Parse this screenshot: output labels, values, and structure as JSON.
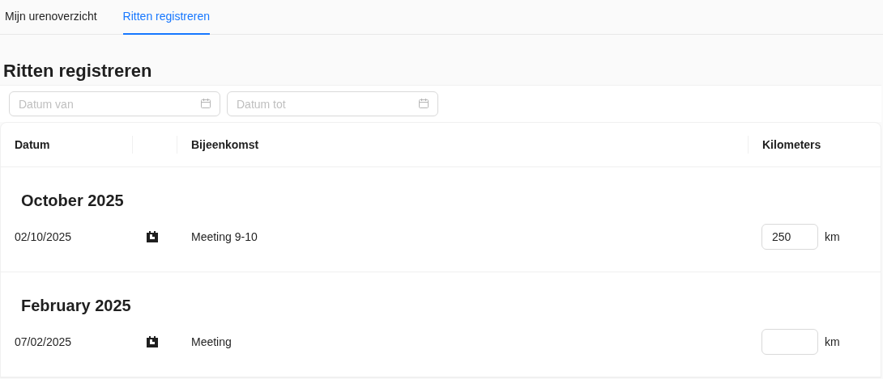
{
  "tabs": [
    {
      "label": "Mijn urenoverzicht",
      "selected": false
    },
    {
      "label": "Ritten registreren",
      "selected": true
    }
  ],
  "page_title": "Ritten registreren",
  "filters": [
    {
      "placeholder": "Datum van"
    },
    {
      "placeholder": "Datum tot"
    }
  ],
  "table": {
    "columns": [
      "Datum",
      "",
      "Bijeenkomst",
      "Kilometers"
    ],
    "groups": [
      {
        "month": "October 2025",
        "rows": [
          {
            "date": "02/10/2025",
            "meeting": "Meeting 9-10",
            "km": "250",
            "unit": "km"
          }
        ]
      },
      {
        "month": "February 2025",
        "rows": [
          {
            "date": "07/02/2025",
            "meeting": "Meeting",
            "unit": "km"
          }
        ]
      }
    ]
  }
}
